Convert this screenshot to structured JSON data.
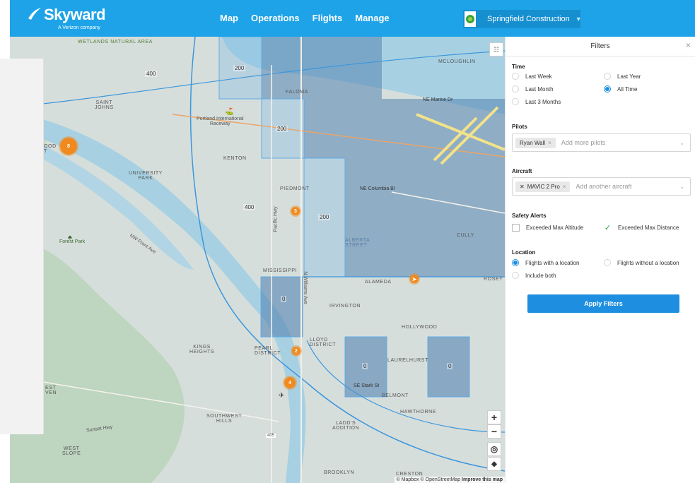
{
  "app": {
    "brand": "Skyward",
    "brand_sub": "A Verizon company",
    "nav": [
      {
        "label": "Map"
      },
      {
        "label": "Operations"
      },
      {
        "label": "Flights"
      },
      {
        "label": "Manage"
      }
    ],
    "org_name": "Springfield Construction",
    "accent_color": "#1ea3e8"
  },
  "map": {
    "labels": {
      "wetlands": "Wetlands Natural Area",
      "mcloughlin": "MCLOUGHLIN",
      "saint_johns": "SAINT\nJOHNS",
      "faloma": "FALOMA",
      "portland_raceway": "Portland International\nRaceway",
      "kenton": "KENTON",
      "university_park": "UNIVERSITY\nPARK",
      "piedmont": "PIEDMONT",
      "forest_park": "Forest Park",
      "alberta": "ALBERTA\nSTREET",
      "cully": "CULLY",
      "mississippi": "MISSISSIPPI",
      "alameda": "ALAMEDA",
      "rosey": "ROSEY",
      "irvington": "IRVINGTON",
      "hollywood": "HOLLYWOOD",
      "kings_heights": "KINGS\nHEIGHTS",
      "pearl": "PEARL\nDISTRICT",
      "lloyd": "LLOYD\nDISTRICT",
      "laurelhurst": "LAURELHURST",
      "belmont": "BELMONT",
      "hawthorne": "HAWTHORNE",
      "southwest_hills": "SOUTHWEST\nHILLS",
      "ladds": "LADD'S\nADDITION",
      "west_slope": "WEST\nSLOPE",
      "brooklyn": "BROOKLYN",
      "creston": "CRESTON",
      "est_ven": "EST\nVEN",
      "ood_t": "OOD\nT",
      "mariner": "NE Marine Dr",
      "columbia": "NE Columbia Bl",
      "nw_front": "NW Front Ave",
      "pacific_hwy": "Pacific Hwy",
      "n_williams": "N Williams Ave",
      "se_stark": "SE Stark St",
      "sunset": "Sunset Hwy",
      "i405": "405"
    },
    "altitudes": [
      "400",
      "200",
      "200",
      "400",
      "200",
      "0",
      "0",
      "0"
    ],
    "clusters": [
      "8",
      "3",
      "2",
      "4"
    ],
    "attribution": "© Mapbox © OpenStreetMap",
    "improve": "Improve this map",
    "zoom_in": "+",
    "zoom_out": "−"
  },
  "filters": {
    "title": "Filters",
    "time": {
      "title": "Time",
      "options": [
        {
          "label": "Last Week",
          "selected": false
        },
        {
          "label": "Last Year",
          "selected": false
        },
        {
          "label": "Last Month",
          "selected": false
        },
        {
          "label": "All Time",
          "selected": true
        },
        {
          "label": "Last 3 Months",
          "selected": false
        }
      ]
    },
    "pilots": {
      "title": "Pilots",
      "chip": "Ryan Wall",
      "placeholder": "Add more pilots"
    },
    "aircraft": {
      "title": "Aircraft",
      "chip": "MAVIC 2 Pro",
      "placeholder": "Add another aircraft"
    },
    "safety": {
      "title": "Safety Alerts",
      "options": [
        {
          "label": "Exceeded Max Altitude",
          "checked": false
        },
        {
          "label": "Exceeded Max Distance",
          "checked": true
        }
      ]
    },
    "location": {
      "title": "Location",
      "options": [
        {
          "label": "Flights with a location",
          "selected": true
        },
        {
          "label": "Flights without a location",
          "selected": false
        },
        {
          "label": "Include both",
          "selected": false
        }
      ]
    },
    "apply": "Apply Filters"
  }
}
